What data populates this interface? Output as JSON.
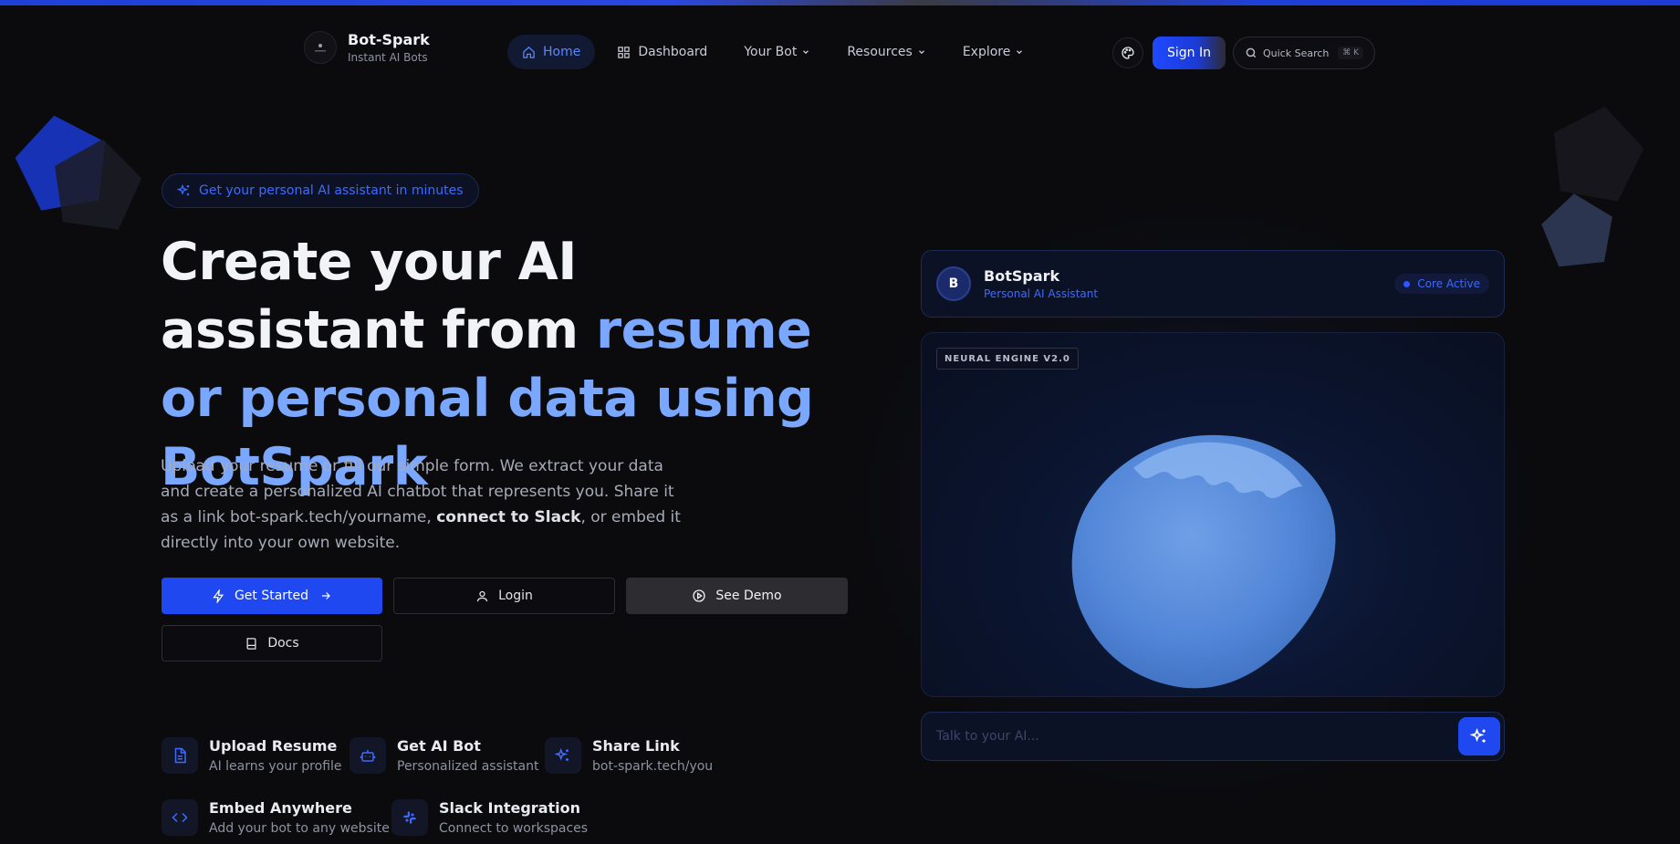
{
  "brand": {
    "name": "Bot-Spark",
    "tagline": "Instant AI Bots",
    "logo_text": "BOT-SPARK"
  },
  "nav": {
    "items": [
      {
        "label": "Home",
        "icon": "home-icon",
        "active": true
      },
      {
        "label": "Dashboard",
        "icon": "grid-icon",
        "active": false
      },
      {
        "label": "Your Bot",
        "dropdown": true
      },
      {
        "label": "Resources",
        "dropdown": true
      },
      {
        "label": "Explore",
        "dropdown": true
      }
    ]
  },
  "header": {
    "signin_label": "Sign In",
    "search_label": "Quick Search",
    "search_shortcut": "⌘ K"
  },
  "hero": {
    "badge": "Get your personal AI assistant in minutes",
    "title_part1": "Create your AI assistant from ",
    "title_highlight": "resume or personal data using BotSpark",
    "desc_part1": "Upload your resume or fill our simple form. We extract your data and create a personalized AI chatbot that represents you. Share it as a link bot-spark.tech/yourname, ",
    "desc_bold": "connect to Slack",
    "desc_part2": ", or embed it directly into your own website."
  },
  "buttons": {
    "get_started": "Get Started",
    "login": "Login",
    "see_demo": "See Demo",
    "docs": "Docs"
  },
  "features": [
    {
      "title": "Upload Resume",
      "subtitle": "AI learns your profile",
      "icon": "document-icon"
    },
    {
      "title": "Get AI Bot",
      "subtitle": "Personalized assistant",
      "icon": "robot-icon"
    },
    {
      "title": "Share Link",
      "subtitle": "bot-spark.tech/you",
      "icon": "sparkles-icon"
    },
    {
      "title": "Embed Anywhere",
      "subtitle": "Add your bot to any website",
      "icon": "code-icon"
    },
    {
      "title": "Slack Integration",
      "subtitle": "Connect to workspaces",
      "icon": "slack-icon"
    }
  ],
  "bot_card": {
    "avatar_letter": "B",
    "name": "BotSpark",
    "subtitle": "Personal AI Assistant",
    "status": "Core Active"
  },
  "engine": {
    "tag": "NEURAL ENGINE V2.0"
  },
  "chat": {
    "placeholder": "Talk to your AI..."
  },
  "colors": {
    "accent": "#1f48f0",
    "highlight": "#7aa7ff",
    "background": "#0b0b0e"
  }
}
